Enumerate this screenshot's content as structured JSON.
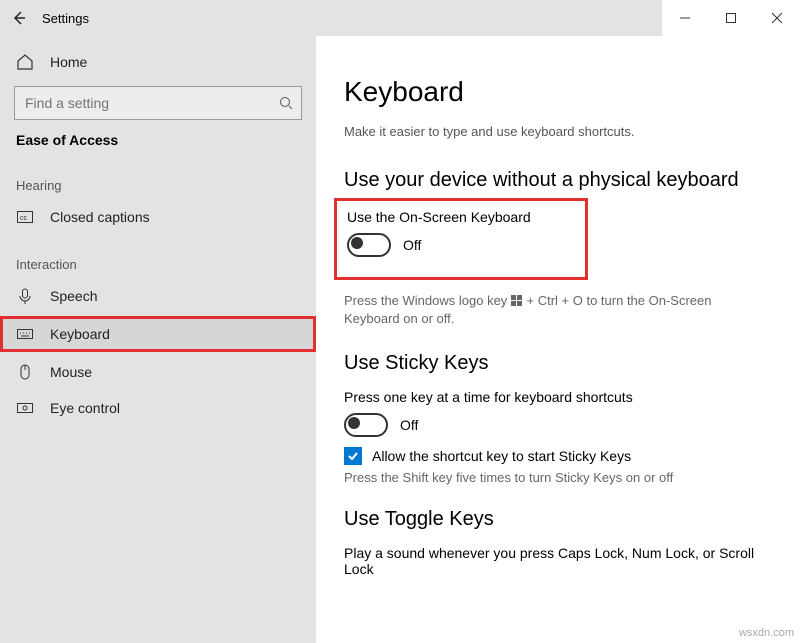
{
  "titlebar": {
    "title": "Settings"
  },
  "sidebar": {
    "home": "Home",
    "search_placeholder": "Find a setting",
    "breadcrumb": "Ease of Access",
    "cat_hearing": "Hearing",
    "cat_interaction": "Interaction",
    "items": {
      "closed_captions": "Closed captions",
      "speech": "Speech",
      "keyboard": "Keyboard",
      "mouse": "Mouse",
      "eye_control": "Eye control"
    }
  },
  "content": {
    "h1": "Keyboard",
    "desc": "Make it easier to type and use keyboard shortcuts.",
    "section_device": "Use your device without a physical keyboard",
    "onscreen": {
      "label": "Use the On-Screen Keyboard",
      "state": "Off",
      "hint_before": "Press the Windows logo key ",
      "hint_after": " + Ctrl + O to turn the On-Screen Keyboard on or off."
    },
    "section_sticky": "Use Sticky Keys",
    "sticky": {
      "label": "Press one key at a time for keyboard shortcuts",
      "state": "Off",
      "checkbox": "Allow the shortcut key to start Sticky Keys",
      "hint": "Press the Shift key five times to turn Sticky Keys on or off"
    },
    "section_toggle": "Use Toggle Keys",
    "toggle_hint": "Play a sound whenever you press Caps Lock, Num Lock, or Scroll Lock"
  },
  "watermark": "wsxdn.com"
}
